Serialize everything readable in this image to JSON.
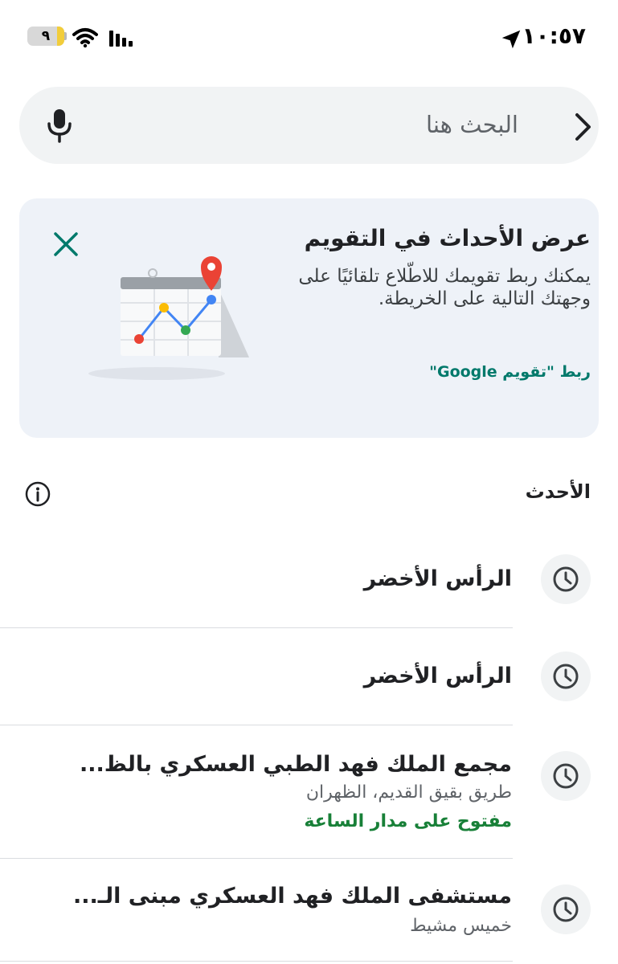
{
  "status_bar": {
    "time": "١٠:٥٧",
    "battery_level": "٩",
    "battery_fraction": 0.2,
    "icons": [
      "location-arrow-icon",
      "wifi-icon",
      "cellular-signal-icon",
      "battery-icon"
    ]
  },
  "search": {
    "placeholder": "البحث هنا",
    "icons": [
      "chevron-back-icon",
      "microphone-icon"
    ]
  },
  "calendar_card": {
    "title": "عرض الأحداث في التقويم",
    "description": "يمكنك ربط تقويمك للاطّلاع تلقائيًا على وجهتك التالية على الخريطة.",
    "link_label": "ربط \"تقويم Google\"",
    "icons": [
      "close-icon",
      "calendar-map-illustration"
    ],
    "colors": {
      "link": "#00796b",
      "close": "#00796b",
      "background": "#eef2f8"
    }
  },
  "recent": {
    "title": "الأحدث",
    "items": [
      {
        "title": "الرأس الأخضر",
        "subtitle": "",
        "status": ""
      },
      {
        "title": "الرأس الأخضر",
        "subtitle": "",
        "status": ""
      },
      {
        "title": "مجمع الملك فهد الطبي العسكري بالظ...",
        "subtitle": "طريق بقيق القديم، الظهران",
        "status": "مفتوح على مدار الساعة"
      },
      {
        "title": "مستشفى الملك فهد العسكري مبنى الـ...",
        "subtitle": "خميس مشيط",
        "status": ""
      }
    ],
    "icons": [
      "info-icon",
      "clock-icon"
    ],
    "colors": {
      "open_status": "#188038"
    }
  }
}
